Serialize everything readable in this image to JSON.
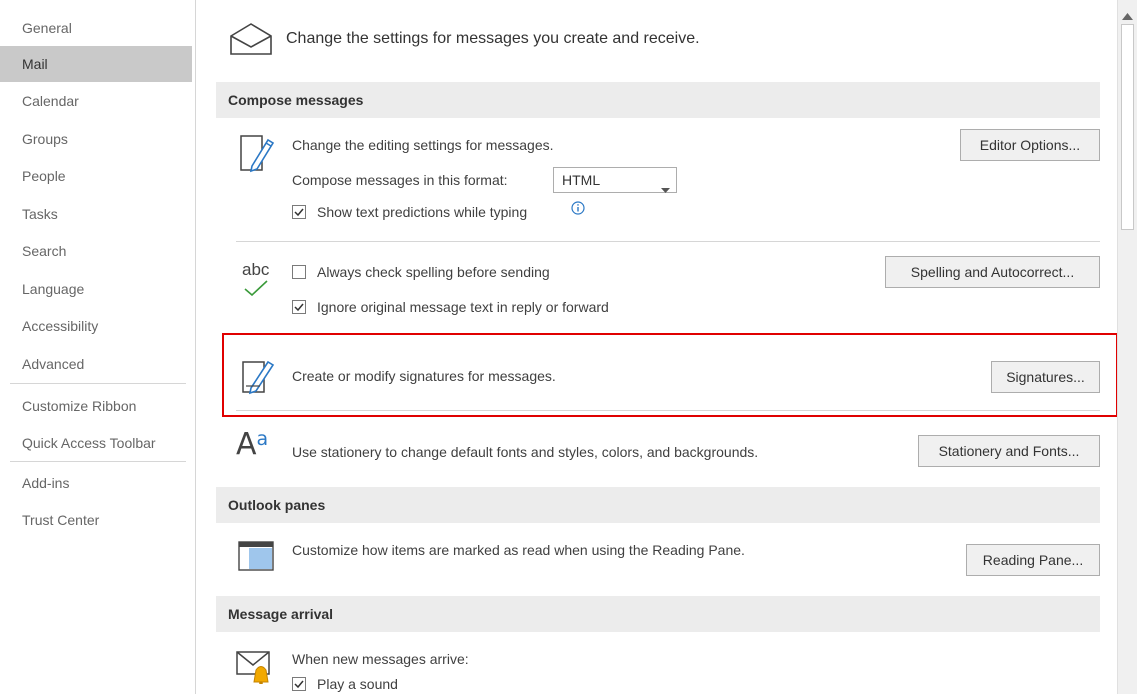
{
  "sidebar": {
    "items": [
      {
        "label": "General"
      },
      {
        "label": "Mail",
        "selected": true
      },
      {
        "label": "Calendar"
      },
      {
        "label": "Groups"
      },
      {
        "label": "People"
      },
      {
        "label": "Tasks"
      },
      {
        "label": "Search"
      },
      {
        "label": "Language"
      },
      {
        "label": "Accessibility"
      },
      {
        "label": "Advanced"
      },
      {
        "label": "Customize Ribbon"
      },
      {
        "label": "Quick Access Toolbar"
      },
      {
        "label": "Add-ins"
      },
      {
        "label": "Trust Center"
      }
    ]
  },
  "header": {
    "text": "Change the settings for messages you create and receive.",
    "icon": "envelope-open-icon"
  },
  "compose": {
    "title": "Compose messages",
    "editing_text": "Change the editing settings for messages.",
    "editor_button": "Editor Options...",
    "format_label": "Compose messages in this format:",
    "format_value": "HTML",
    "show_predictions_label": "Show text predictions while typing",
    "show_predictions_checked": true,
    "abc_label": "abc",
    "always_check_label": "Always check spelling before sending",
    "always_check_checked": false,
    "ignore_original_label": "Ignore original message text in reply or forward",
    "ignore_original_checked": true,
    "spelling_button": "Spelling and Autocorrect...",
    "signatures_text": "Create or modify signatures for messages.",
    "signatures_button": "Signatures...",
    "stationery_glyph": "A",
    "stationery_glyph_super": "a",
    "stationery_text": "Use stationery to change default fonts and styles, colors, and backgrounds.",
    "stationery_button": "Stationery and Fonts..."
  },
  "panes": {
    "title": "Outlook panes",
    "reading_text": "Customize how items are marked as read when using the Reading Pane.",
    "reading_button": "Reading Pane..."
  },
  "arrival": {
    "title": "Message arrival",
    "when_new_text": "When new messages arrive:",
    "play_sound_label": "Play a sound",
    "play_sound_checked": true
  },
  "colors": {
    "highlight": "#e00000",
    "selected_nav": "#c9c9c9",
    "section_bg": "#ececec",
    "icon_blue": "#2b78c5",
    "check_green": "#3a9a3a"
  }
}
